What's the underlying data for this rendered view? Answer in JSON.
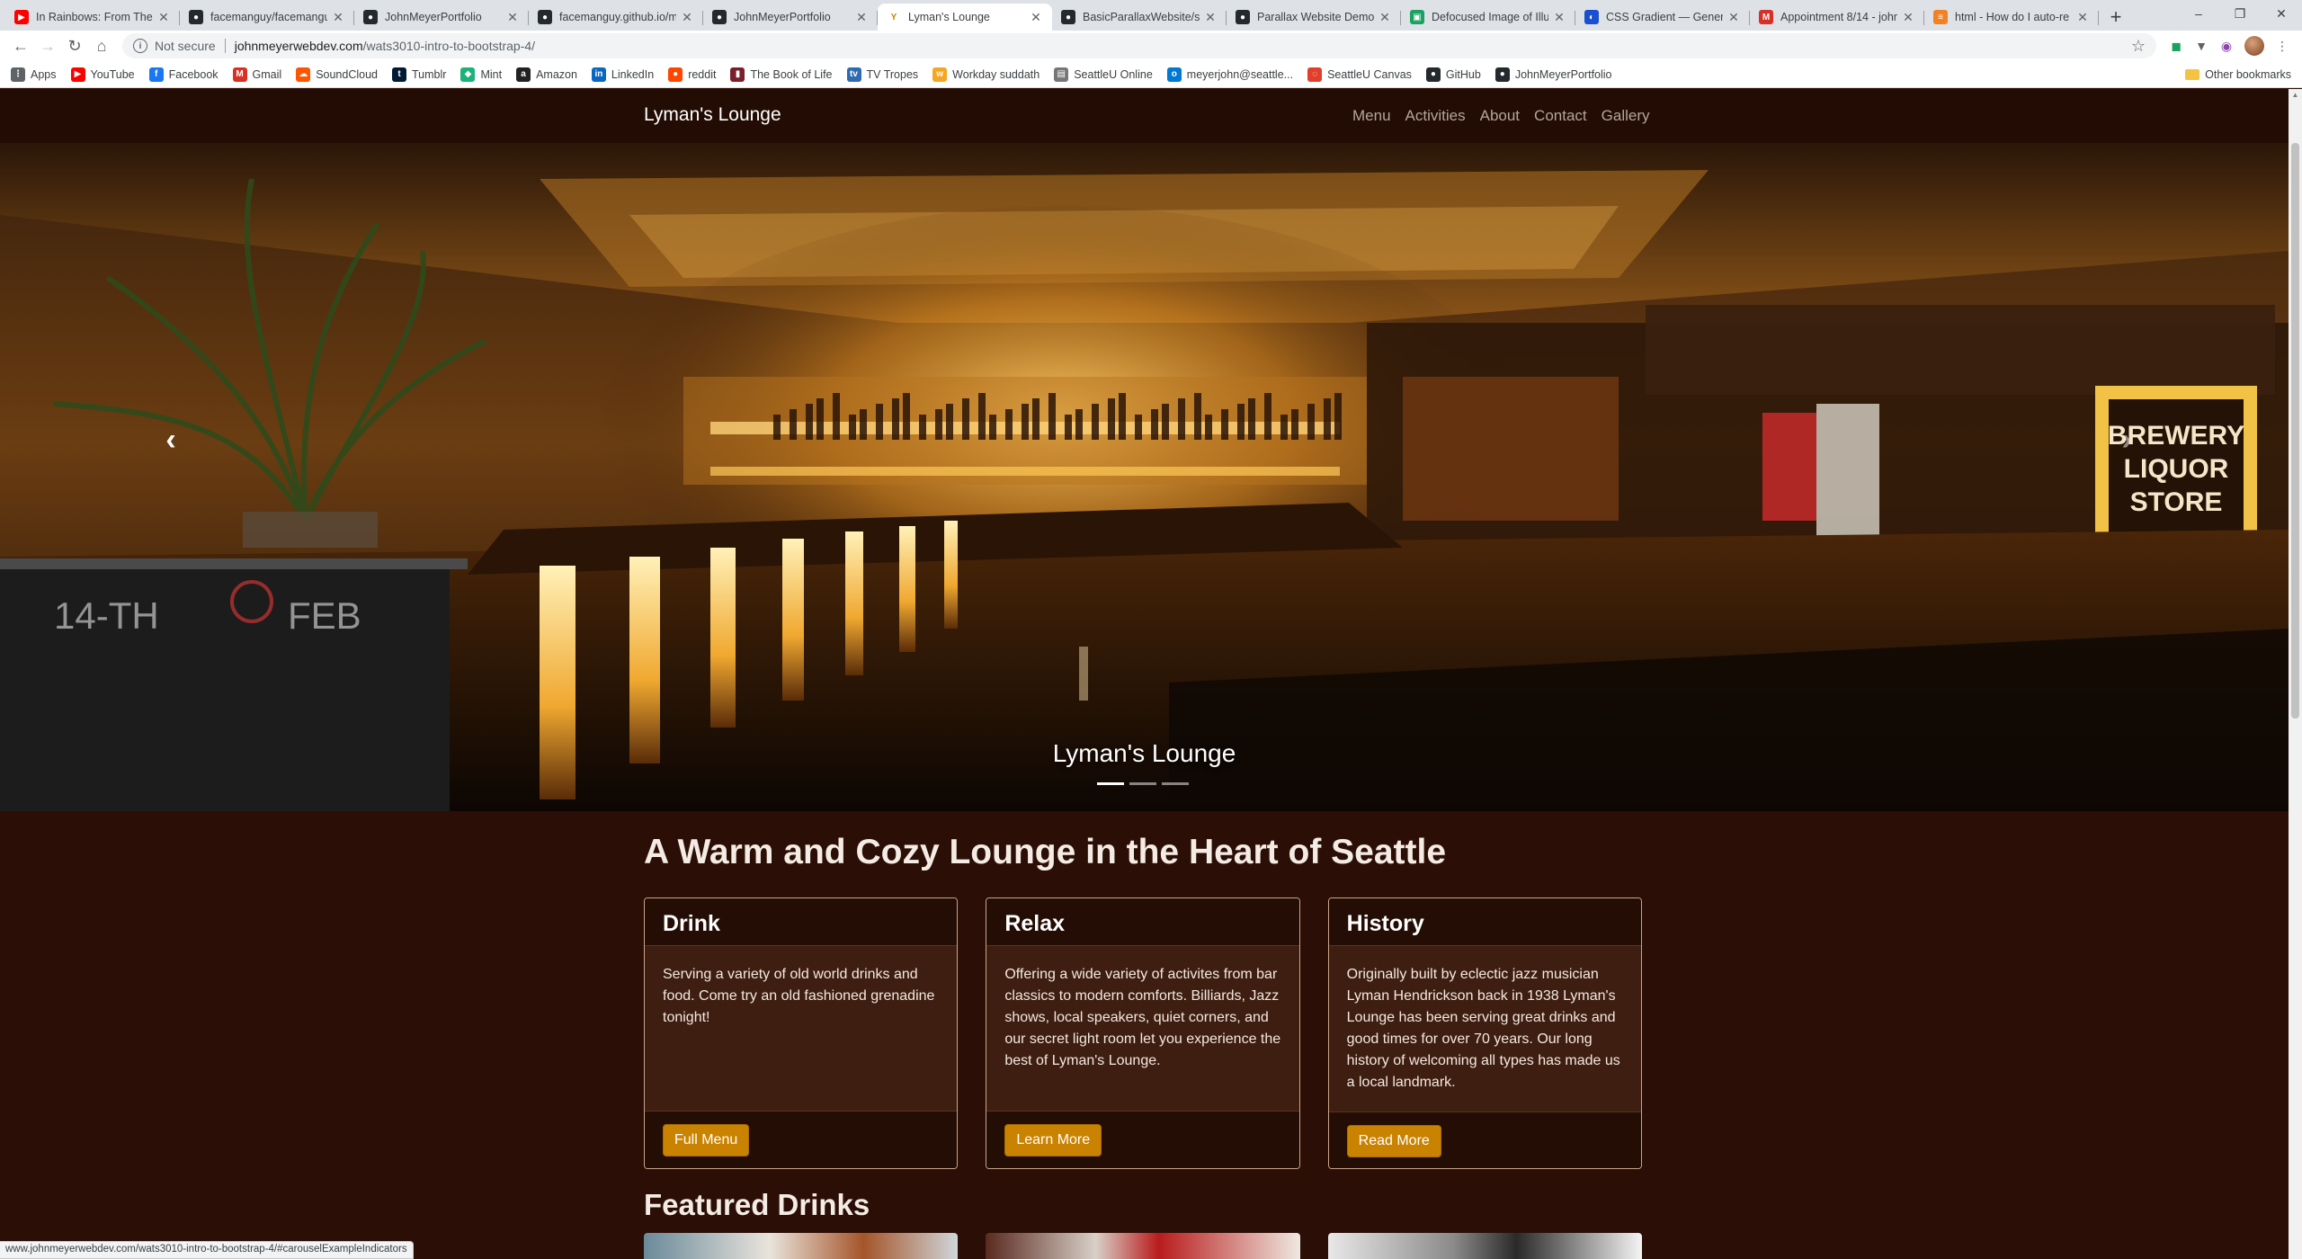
{
  "browser": {
    "tabs": [
      {
        "title": "In Rainbows: From The B",
        "icon": "youtube-icon",
        "color": "#ff0000"
      },
      {
        "title": "facemanguy/facemanguy",
        "icon": "github-icon",
        "color": "#24292e"
      },
      {
        "title": "JohnMeyerPortfolio",
        "icon": "github-icon",
        "color": "#24292e"
      },
      {
        "title": "facemanguy.github.io/m",
        "icon": "github-icon",
        "color": "#24292e"
      },
      {
        "title": "JohnMeyerPortfolio",
        "icon": "github-icon",
        "color": "#24292e"
      },
      {
        "title": "Lyman's Lounge",
        "icon": "cocktail-icon",
        "color": "#c98300",
        "active": true
      },
      {
        "title": "BasicParallaxWebsite/sty",
        "icon": "github-icon",
        "color": "#24292e"
      },
      {
        "title": "Parallax Website Demo",
        "icon": "github-icon",
        "color": "#24292e"
      },
      {
        "title": "Defocused Image of Illu",
        "icon": "image-icon",
        "color": "#1aa260"
      },
      {
        "title": "CSS Gradient — Genera",
        "icon": "gradient-icon",
        "color": "#1b4fd1"
      },
      {
        "title": "Appointment 8/14 - john",
        "icon": "gmail-icon",
        "color": "#d93025"
      },
      {
        "title": "html - How do I auto-re",
        "icon": "stackoverflow-icon",
        "color": "#f48024"
      }
    ],
    "new_tab": "+",
    "window_controls": {
      "minimize": "–",
      "restore": "❐",
      "close": "✕"
    },
    "nav": {
      "back": "←",
      "forward": "→",
      "reload": "↻",
      "home": "⌂"
    },
    "address": {
      "security": "Not secure",
      "host": "johnmeyerwebdev.com",
      "path": "/wats3010-intro-to-bootstrap-4/"
    },
    "bookmarks": [
      {
        "label": "Apps",
        "icon": "apps-icon",
        "color": "#5f6368"
      },
      {
        "label": "YouTube",
        "icon": "youtube-icon",
        "color": "#ff0000"
      },
      {
        "label": "Facebook",
        "icon": "facebook-icon",
        "color": "#1877f2"
      },
      {
        "label": "Gmail",
        "icon": "gmail-icon",
        "color": "#d93025"
      },
      {
        "label": "SoundCloud",
        "icon": "soundcloud-icon",
        "color": "#ff5500"
      },
      {
        "label": "Tumblr",
        "icon": "tumblr-icon",
        "color": "#001935"
      },
      {
        "label": "Mint",
        "icon": "mint-icon",
        "color": "#1bb37a"
      },
      {
        "label": "Amazon",
        "icon": "amazon-icon",
        "color": "#222222"
      },
      {
        "label": "LinkedIn",
        "icon": "linkedin-icon",
        "color": "#0a66c2"
      },
      {
        "label": "reddit",
        "icon": "reddit-icon",
        "color": "#ff4500"
      },
      {
        "label": "The Book of Life",
        "icon": "book-icon",
        "color": "#7a1f2b"
      },
      {
        "label": "TV Tropes",
        "icon": "tvtropes-icon",
        "color": "#2f6bb0"
      },
      {
        "label": "Workday suddath",
        "icon": "workday-icon",
        "color": "#f5a623"
      },
      {
        "label": "SeattleU Online",
        "icon": "page-icon",
        "color": "#777777"
      },
      {
        "label": "meyerjohn@seattle...",
        "icon": "outlook-icon",
        "color": "#0078d4"
      },
      {
        "label": "SeattleU Canvas",
        "icon": "canvas-icon",
        "color": "#e13f2b"
      },
      {
        "label": "GitHub",
        "icon": "github-icon",
        "color": "#24292e"
      },
      {
        "label": "JohnMeyerPortfolio",
        "icon": "github-icon",
        "color": "#24292e"
      }
    ],
    "other_bookmarks": "Other bookmarks",
    "status_url": "www.johnmeyerwebdev.com/wats3010-intro-to-bootstrap-4/#carouselExampleIndicators"
  },
  "site": {
    "brand": "Lyman's Lounge",
    "nav_links": [
      "Menu",
      "Activities",
      "About",
      "Contact",
      "Gallery"
    ],
    "carousel": {
      "caption": "Lyman's Lounge",
      "prev": "‹",
      "next": "›",
      "slides": 3,
      "active_slide": 1,
      "sign_text": [
        "BREWERY",
        "LIQUOR",
        "STORE"
      ],
      "chalk_text": [
        "14-TH",
        "FEB"
      ]
    },
    "headline": "A Warm and Cozy Lounge in the Heart of Seattle",
    "cards": [
      {
        "title": "Drink",
        "body": "Serving a variety of old world drinks and food. Come try an old fashioned grenadine tonight!",
        "button": "Full Menu"
      },
      {
        "title": "Relax",
        "body": "Offering a wide variety of activites from bar classics to modern comforts. Billiards, Jazz shows, local speakers, quiet corners, and our secret light room let you experience the best of Lyman's Lounge.",
        "button": "Learn More"
      },
      {
        "title": "History",
        "body": "Originally built by eclectic jazz musician Lyman Hendrickson back in 1938 Lyman's Lounge has been serving great drinks and good times for over 70 years. Our long history of welcoming all types has made us a local landmark.",
        "button": "Read More"
      }
    ],
    "featured_heading": "Featured Drinks"
  },
  "colors": {
    "page_bg": "#2b0e05",
    "navbar_bg": "#220c04",
    "accent": "#c98300",
    "card_border": "#c9a58a"
  }
}
